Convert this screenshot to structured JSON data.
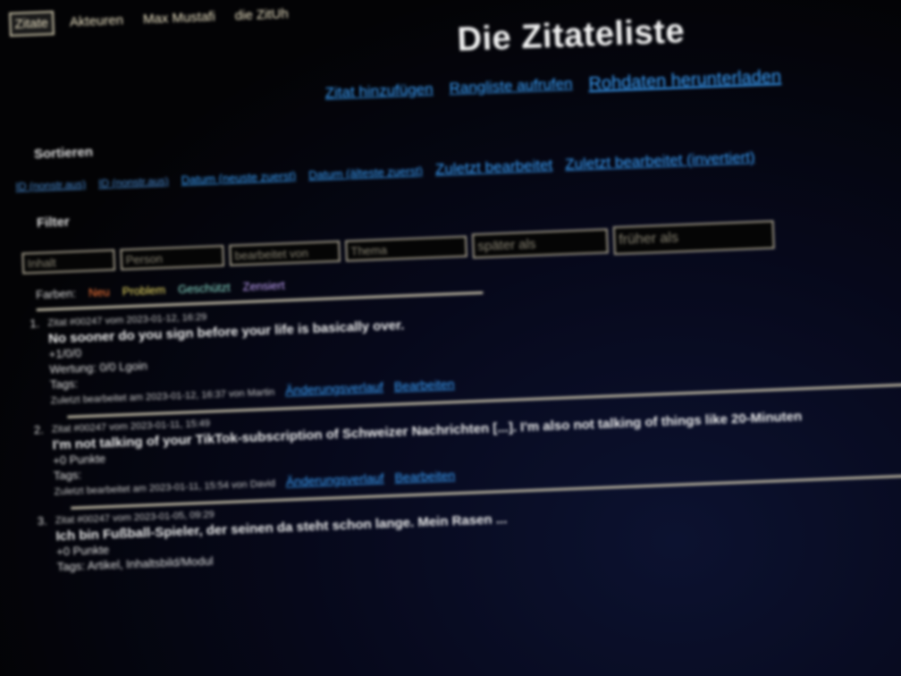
{
  "nav": {
    "items": [
      "Zitate",
      "Akteuren",
      "Max Mustafi",
      "die ZitUh"
    ]
  },
  "title": "Die Zitateliste",
  "actions": [
    "Zitat hinzufügen",
    "Rangliste aufrufen",
    "Rohdaten herunterladen"
  ],
  "sort": {
    "label": "Sortieren",
    "links": [
      "ID (nonstr.aus)",
      "ID (nonstr.aus)",
      "Datum (neuste zuerst)",
      "Datum (älteste zuerst)",
      "Zuletzt bearbeitet",
      "Zuletzt bearbeitet (invertiert)"
    ]
  },
  "filter": {
    "label": "Filter",
    "placeholders": [
      "Inhalt",
      "Person",
      "bearbeitet von",
      "Thema",
      "später als",
      "früher als"
    ]
  },
  "colors": {
    "label": "Farben:",
    "items": [
      {
        "name": "Neu",
        "color": "#ff7a3a"
      },
      {
        "name": "Problem",
        "color": "#f4e36a"
      },
      {
        "name": "Geschützt",
        "color": "#8fe3d0"
      },
      {
        "name": "Zensiert",
        "color": "#c8a8ff"
      }
    ]
  },
  "quotes": [
    {
      "num": "1.",
      "header": "Zitat #00247 vom 2023-01-12, 16:29",
      "text": "No sooner do you sign before your life is basically over.",
      "line3": "+1/0/0",
      "line4": "Wertung: 0/0 Lgoin",
      "line5": "Tags:",
      "edited": "Zuletzt bearbeitet am 2023-01-12, 16:37 von Martin",
      "link1": "Änderungsverlauf",
      "link2": "Bearbeiten"
    },
    {
      "num": "2.",
      "header": "Zitat #00247 vom 2023-01-11, 15:49",
      "text": "I'm not talking of your TikTok-subscription of Schweizer Nachrichten [...]. I'm also not talking of things like 20-Minuten",
      "line3": "+0 Punkte",
      "line4": "Tags:",
      "line5": "",
      "edited": "Zuletzt bearbeitet am 2023-01-11, 15:54 von David",
      "link1": "Änderungsverlauf",
      "link2": "Bearbeiten"
    },
    {
      "num": "3.",
      "header": "Zitat #00247 vom 2023-01-05, 09:29",
      "text": "Ich bin Fußball-Spieler, der seinen da steht schon lange. Mein Rasen ...",
      "line3": "+0 Punkte",
      "line4": "Tags: Artikel, Inhaltsbild/Modul",
      "line5": "",
      "edited": "",
      "link1": "",
      "link2": ""
    }
  ]
}
